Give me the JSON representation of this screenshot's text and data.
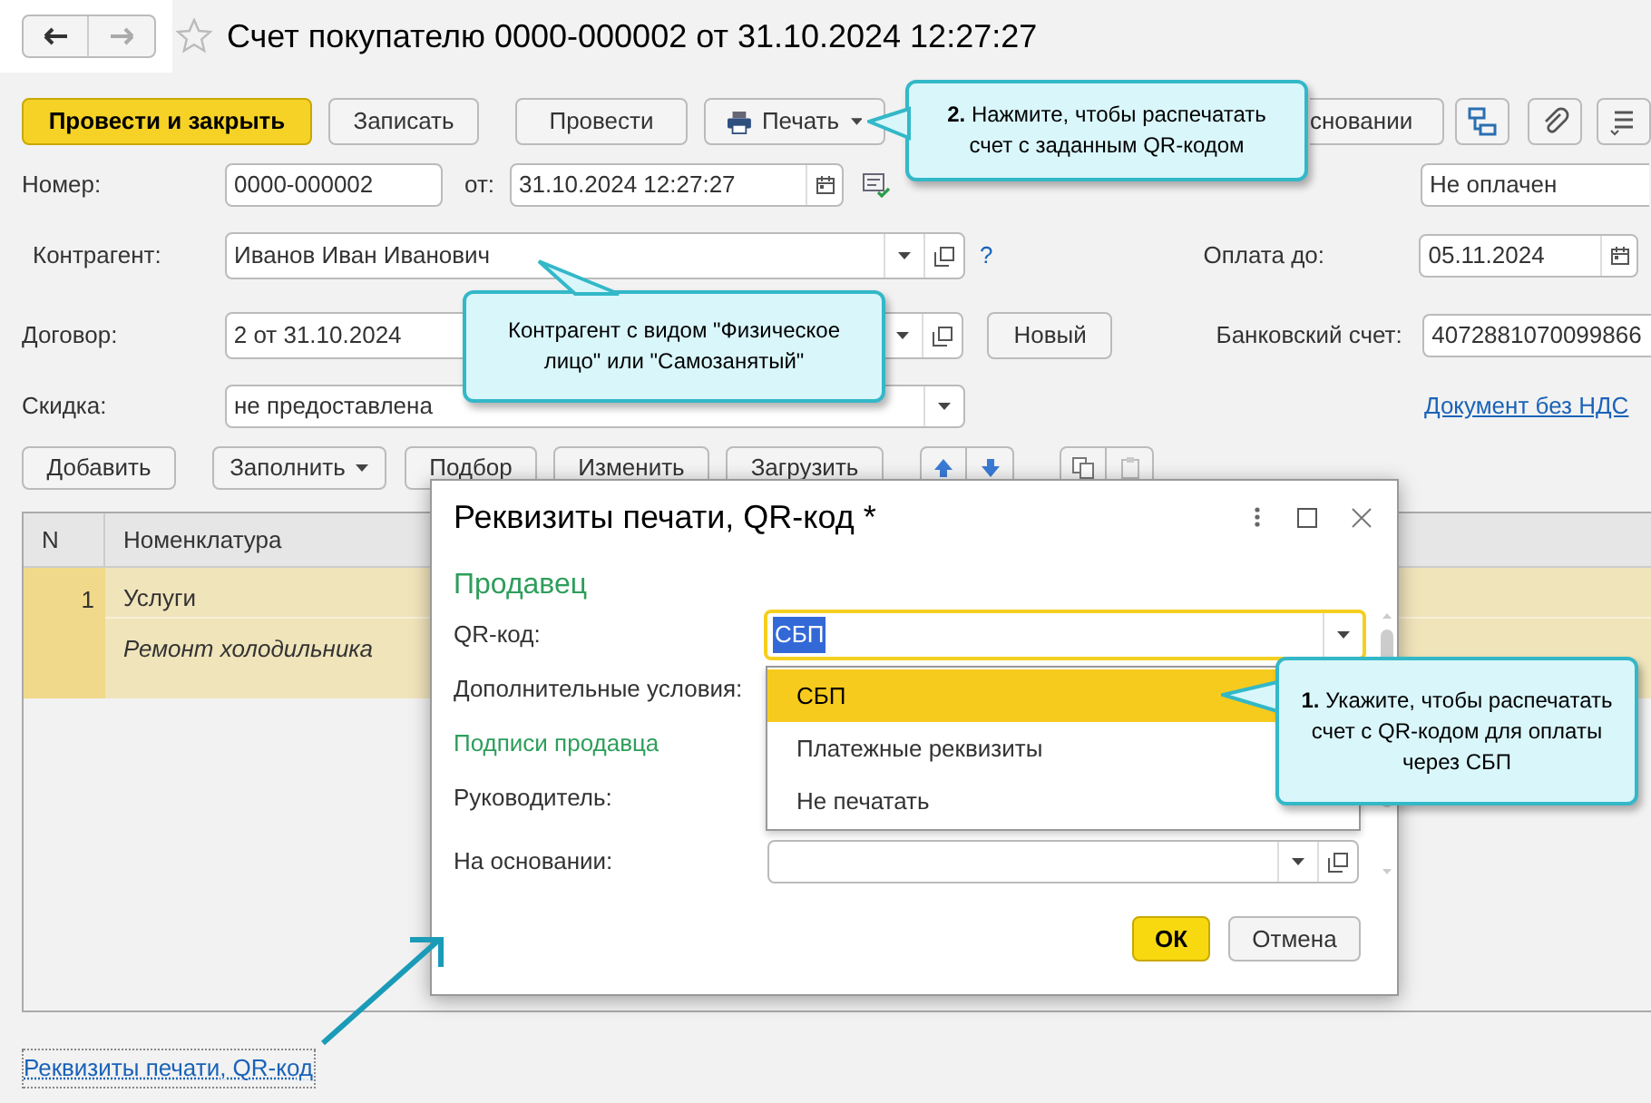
{
  "title": "Счет покупателю 0000-000002 от 31.10.2024 12:27:27",
  "toolbar": [
    {
      "label": "Провести и закрыть",
      "kind": "primary"
    },
    {
      "label": "Записать",
      "kind": "plain"
    },
    {
      "label": "Провести",
      "kind": "plain"
    },
    {
      "label": "Печать",
      "kind": "print"
    },
    {
      "label": "сновании",
      "kind": "menu"
    }
  ],
  "number": {
    "label": "Номер:",
    "value": "0000-000002"
  },
  "date": {
    "label": "от:",
    "value": "31.10.2024 12:27:27"
  },
  "status": {
    "value": "Не оплачен"
  },
  "counterparty": {
    "label": "Контрагент:",
    "value": "Иванов Иван Иванович",
    "help": "?"
  },
  "pay_until": {
    "label": "Оплата до:",
    "value": "05.11.2024"
  },
  "contract": {
    "label": "Договор:",
    "value": "2 от 31.10.2024",
    "button": "Новый"
  },
  "bank_account": {
    "label": "Банковский счет:",
    "value": "4072881070099866"
  },
  "discount": {
    "label": "Скидка:",
    "value": "не предоставлена"
  },
  "vat_link": "Документ без НДС",
  "table_toolbar": [
    {
      "label": "Добавить",
      "kind": "plain"
    },
    {
      "label": "Заполнить",
      "kind": "menu"
    },
    {
      "label": "Подбор",
      "kind": "plain"
    },
    {
      "label": "Изменить",
      "kind": "plain"
    },
    {
      "label": "Загрузить",
      "kind": "plain"
    }
  ],
  "table": {
    "columns": [
      "N",
      "Номенклатура"
    ],
    "rows": [
      {
        "n": "1",
        "item": "Услуги",
        "content": "Ремонт холодильника",
        "selected": true
      }
    ]
  },
  "print_link": "Реквизиты печати, QR-код",
  "dialog": {
    "title": "Реквизиты печати, QR-код *",
    "section": "Продавец",
    "qr": {
      "label": "QR-код:",
      "value": "СБП"
    },
    "options": [
      {
        "label": "СБП",
        "selected": true
      },
      {
        "label": "Платежные реквизиты",
        "selected": false
      },
      {
        "label": "Не печатать",
        "selected": false
      }
    ],
    "extra_label": "Дополнительные условия:",
    "signatures": "Подписи продавца",
    "head_label": "Руководитель:",
    "basis_label": "На основании:",
    "buttons": [
      {
        "label": "ОК",
        "kind": "default"
      },
      {
        "label": "Отмена",
        "kind": "plain"
      }
    ]
  },
  "callouts": [
    {
      "kind": "print",
      "text": "**2.** Нажмите, чтобы распечатать счет с заданным QR-кодом"
    },
    {
      "kind": "counterparty",
      "text": "Контрагент с видом \"Физическое лицо\" или \"Самозанятый\""
    },
    {
      "kind": "qr",
      "text": "**1.** Укажите, чтобы распечатать счет с QR-кодом для оплаты через СБП"
    }
  ]
}
